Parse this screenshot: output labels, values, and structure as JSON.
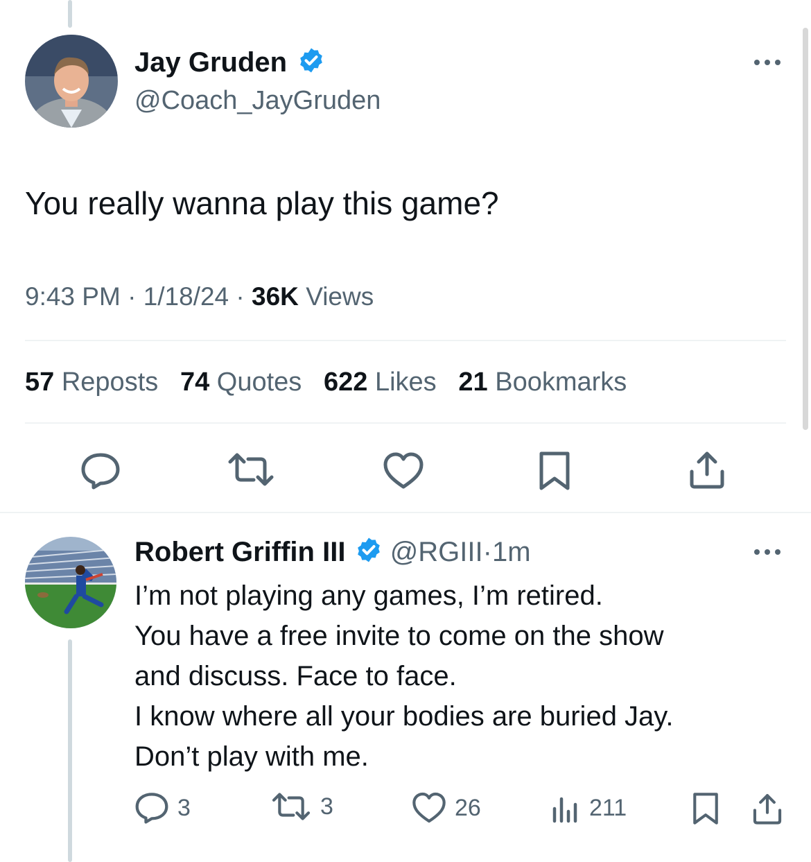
{
  "main_tweet": {
    "author_name": "Jay Gruden",
    "handle": "@Coach_JayGruden",
    "text": "You really wanna play this game?",
    "time": "9:43 PM",
    "date": "1/18/24",
    "views_count": "36K",
    "views_label": "Views",
    "sep": "·",
    "stats": {
      "reposts_count": "57",
      "reposts_label": "Reposts",
      "quotes_count": "74",
      "quotes_label": "Quotes",
      "likes_count": "622",
      "likes_label": "Likes",
      "bookmarks_count": "21",
      "bookmarks_label": "Bookmarks"
    }
  },
  "reply_tweet": {
    "author_name": "Robert Griffin III",
    "handle": "@RGIII",
    "sep": "·",
    "time_ago": "1m",
    "lines": [
      "I’m not playing any games, I’m retired.",
      "You have a free invite to come on the show",
      "and discuss. Face to face.",
      "I know where all your bodies are buried Jay.",
      "Don’t play with me."
    ],
    "actions": {
      "replies": "3",
      "reposts": "3",
      "likes": "26",
      "views": "211"
    }
  },
  "colors": {
    "accent": "#1d9bf0",
    "text": "#0f1419",
    "muted": "#536471",
    "divider": "#eff3f4"
  },
  "icons": [
    "verified-badge-icon",
    "more-icon",
    "reply-icon",
    "repost-icon",
    "like-icon",
    "bookmark-icon",
    "share-icon",
    "views-icon"
  ]
}
